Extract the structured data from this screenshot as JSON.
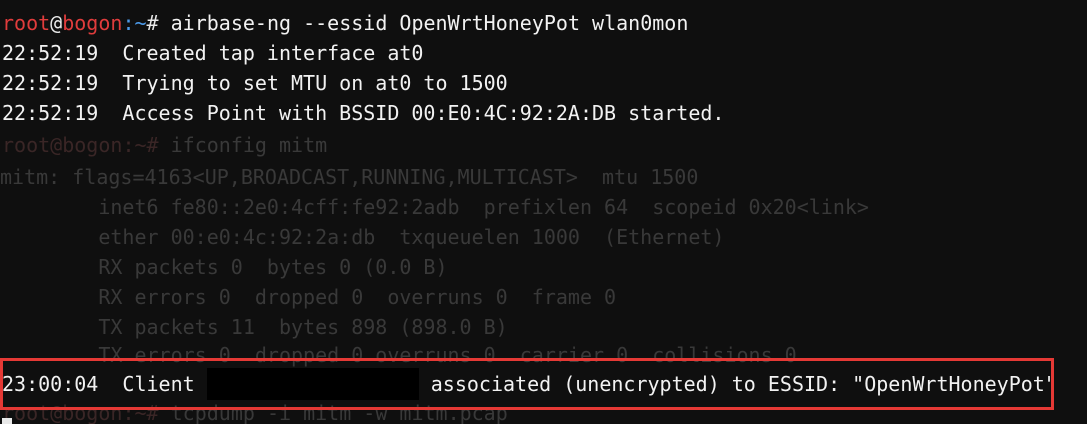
{
  "prompt": {
    "user": "root",
    "at": "@",
    "host": "bogon",
    "path": ":~",
    "symbol": "#"
  },
  "main_output": {
    "command": " airbase-ng --essid OpenWrtHoneyPot wlan0mon",
    "lines": [
      "22:52:19  Created tap interface at0",
      "22:52:19  Trying to set MTU on at0 to 1500",
      "22:52:19  Access Point with BSSID 00:E0:4C:92:2A:DB started."
    ],
    "client_event": {
      "prefix": "23:00:04  Client ",
      "suffix": " associated (unencrypted) to ESSID: \"OpenWrtHoneyPot\""
    }
  },
  "background_output": {
    "ifconfig_command": " ifconfig mitm",
    "lines": [
      "mitm: flags=4163<UP,BROADCAST,RUNNING,MULTICAST>  mtu 1500",
      "        inet6 fe80::2e0:4cff:fe92:2adb  prefixlen 64  scopeid 0x20<link>",
      "        ether 00:e0:4c:92:2a:db  txqueuelen 1000  (Ethernet)",
      "        RX packets 0  bytes 0 (0.0 B)",
      "        RX errors 0  dropped 0  overruns 0  frame 0",
      "        TX packets 11  bytes 898 (898.0 B)",
      "        TX errors 0  dropped 0 overruns 0  carrier 0  collisions 0"
    ],
    "tcpdump_command": " tcpdump -i mitm -w mitm.pcap"
  },
  "colors": {
    "background": "#0f0f0f",
    "text": "#e8e8e8",
    "prompt_user": "#e03c3c",
    "prompt_path": "#4c9ae8",
    "highlight_border": "#e53935",
    "redaction": "#000000"
  }
}
